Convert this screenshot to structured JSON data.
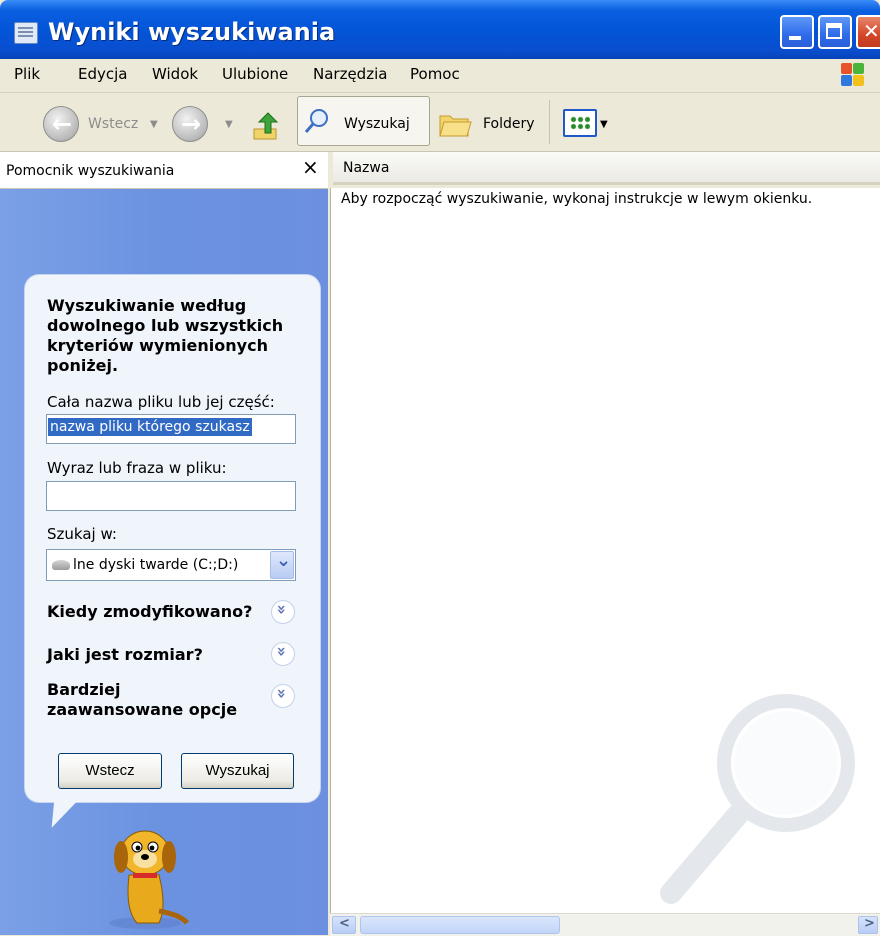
{
  "window": {
    "title": "Wyniki wyszukiwania"
  },
  "menu": {
    "items": [
      "Plik",
      "Edycja",
      "Widok",
      "Ulubione",
      "Narzędzia",
      "Pomoc"
    ]
  },
  "toolbar": {
    "back_label": "Wstecz",
    "search_label": "Wyszukaj",
    "folders_label": "Foldery"
  },
  "search_pane": {
    "header_title": "Pomocnik wyszukiwania",
    "close_symbol": "×",
    "heading": "Wyszukiwanie według dowolnego lub wszystkich kryteriów wymienionych poniżej.",
    "filename_label": "Cała nazwa pliku lub jej część:",
    "filename_value": "nazwa pliku którego szukasz",
    "phrase_label": "Wyraz lub fraza w pliku:",
    "phrase_value": "",
    "look_in_label": "Szukaj w:",
    "look_in_value": "lne dyski twarde (C:;D:)",
    "expanders": [
      "Kiedy zmodyfikowano?",
      "Jaki jest rozmiar?",
      "Bardziej zaawansowane opcje"
    ],
    "back_button": "Wstecz",
    "search_button": "Wyszukaj"
  },
  "results": {
    "column_header": "Nazwa",
    "instruction": "Aby rozpocząć wyszukiwanie, wykonaj instrukcje w lewym okienku."
  }
}
